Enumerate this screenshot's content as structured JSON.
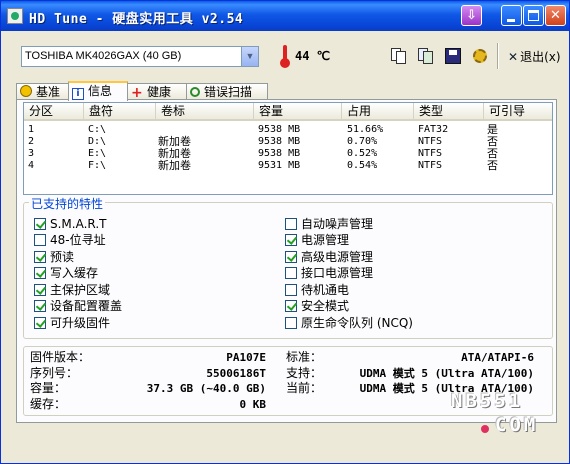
{
  "window": {
    "title": "HD Tune - 硬盘实用工具 v2.54"
  },
  "toolbar": {
    "drive": "TOSHIBA MK4026GAX (40 GB)",
    "temperature": "44 ℃",
    "exit_label": "退出(x)"
  },
  "tabs": [
    {
      "label": "基准",
      "icon": "benchmark-icon"
    },
    {
      "label": "信息",
      "icon": "info-icon"
    },
    {
      "label": "健康",
      "icon": "health-icon"
    },
    {
      "label": "错误扫描",
      "icon": "error-scan-icon"
    }
  ],
  "partitions": {
    "columns": [
      "分区",
      "盘符",
      "卷标",
      "容量",
      "占用",
      "类型",
      "可引导"
    ],
    "rows": [
      [
        "1",
        "C:\\",
        "",
        "9538 MB",
        "51.66%",
        "FAT32",
        "是"
      ],
      [
        "2",
        "D:\\",
        "新加卷",
        "9538 MB",
        "0.70%",
        "NTFS",
        "否"
      ],
      [
        "3",
        "E:\\",
        "新加卷",
        "9538 MB",
        "0.52%",
        "NTFS",
        "否"
      ],
      [
        "4",
        "F:\\",
        "新加卷",
        "9531 MB",
        "0.54%",
        "NTFS",
        "否"
      ]
    ]
  },
  "features": {
    "title": "已支持的特性",
    "left": [
      {
        "label": "S.M.A.R.T",
        "checked": true
      },
      {
        "label": "48-位寻址",
        "checked": false
      },
      {
        "label": "预读",
        "checked": true
      },
      {
        "label": "写入缓存",
        "checked": true
      },
      {
        "label": "主保护区域",
        "checked": true
      },
      {
        "label": "设备配置覆盖",
        "checked": true
      },
      {
        "label": "可升级固件",
        "checked": true
      }
    ],
    "right": [
      {
        "label": "自动噪声管理",
        "checked": false
      },
      {
        "label": "电源管理",
        "checked": true
      },
      {
        "label": "高级电源管理",
        "checked": true
      },
      {
        "label": "接口电源管理",
        "checked": false
      },
      {
        "label": "待机通电",
        "checked": false
      },
      {
        "label": "安全模式",
        "checked": true
      },
      {
        "label": "原生命令队列 (NCQ)",
        "checked": false
      }
    ]
  },
  "info": {
    "firmware_label": "固件版本：",
    "firmware_value": "PA107E",
    "serial_label": "序列号：",
    "serial_value": "55006186T",
    "capacity_label": "容量：",
    "capacity_value": "37.3 GB (~40.0 GB)",
    "cache_label": "缓存：",
    "cache_value": "0 KB",
    "standard_label": "标准：",
    "standard_value": "ATA/ATAPI-6",
    "support_label": "支持：",
    "support_value": "UDMA 模式 5 (Ultra ATA/100)",
    "current_label": "当前：",
    "current_value": "UDMA 模式 5 (Ultra ATA/100)"
  },
  "watermark": {
    "line1": "NB551",
    "line2": "COM"
  }
}
